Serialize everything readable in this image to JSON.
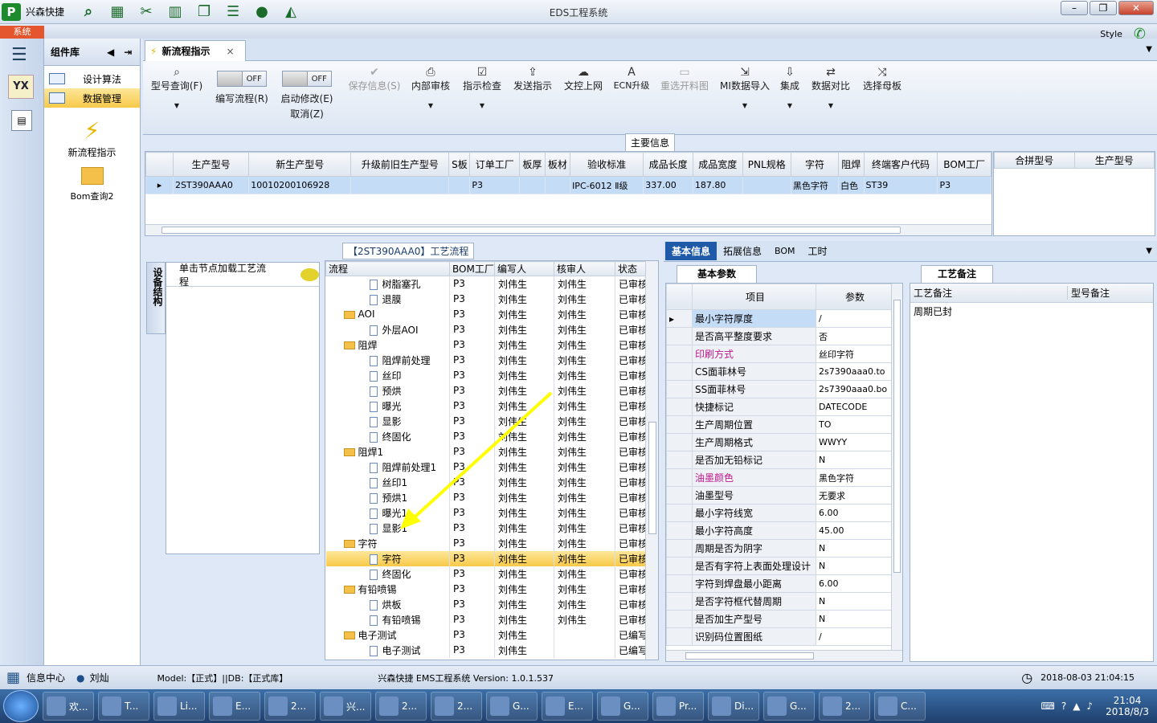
{
  "app": {
    "logo": "P",
    "name": "兴森快捷",
    "window_title": "EDS工程系统",
    "style_label": "Style"
  },
  "menu": {
    "system_tab": "系统"
  },
  "left_icons": [
    "YX",
    "calendar"
  ],
  "library": {
    "title": "组件库",
    "items": [
      {
        "label": "设计算法",
        "selected": false
      },
      {
        "label": "数据管理",
        "selected": true
      }
    ],
    "big_items": [
      {
        "label": "新流程指示",
        "icon": "lightning-icon"
      },
      {
        "label": "Bom查询2",
        "icon": "folder-open-icon"
      }
    ]
  },
  "doc_tab": {
    "label": "新流程指示",
    "close": "×"
  },
  "ribbon": {
    "model_query": "型号查询(F)",
    "toggle_off": "OFF",
    "edit_flow": "编写流程(R)",
    "start_modify": "启动修改(E)",
    "cancel": "取消(Z)",
    "save_info": "保存信息(S)",
    "internal_review": "内部审核",
    "instruction_check": "指示检查",
    "send_instruction": "发送指示",
    "upload": "文控上网",
    "ecn_upgrade": "ECN升级",
    "reselect": "重选开料图",
    "mi_import": "MI数据导入",
    "integrate": "集成",
    "data_compare": "数据对比",
    "select_master": "选择母板"
  },
  "main_info": {
    "title": "主要信息",
    "columns": [
      "生产型号",
      "新生产型号",
      "升级前旧生产型号",
      "S板",
      "订单工厂",
      "板厚",
      "板材",
      "验收标准",
      "成品长度",
      "成品宽度",
      "PNL规格",
      "字符",
      "阻焊",
      "终端客户代码",
      "BOM工厂"
    ],
    "row": [
      "2ST390AAA0",
      "10010200106928",
      "",
      "",
      "P3",
      "",
      "",
      "IPC-6012 Ⅱ级",
      "337.00",
      "187.80",
      "",
      "黑色字符",
      "白色",
      "ST39",
      "P3"
    ],
    "side_columns": [
      "合拼型号",
      "生产型号"
    ]
  },
  "flow": {
    "title": "【2ST390AAA0】工艺流程",
    "side_tab": "设备结构",
    "hint": "单击节点加载工艺流程",
    "columns": [
      "流程",
      "BOM工厂",
      "编写人",
      "核审人",
      "状态"
    ],
    "rows": [
      {
        "level": 2,
        "type": "doc",
        "name": "树脂塞孔",
        "bom": "P3",
        "writer": "刘伟生",
        "reviewer": "刘伟生",
        "status": "已审核"
      },
      {
        "level": 2,
        "type": "doc",
        "name": "退膜",
        "bom": "P3",
        "writer": "刘伟生",
        "reviewer": "刘伟生",
        "status": "已审核"
      },
      {
        "level": 1,
        "type": "folder",
        "name": "AOI",
        "bom": "P3",
        "writer": "刘伟生",
        "reviewer": "刘伟生",
        "status": "已审核"
      },
      {
        "level": 2,
        "type": "doc",
        "name": "外层AOI",
        "bom": "P3",
        "writer": "刘伟生",
        "reviewer": "刘伟生",
        "status": "已审核"
      },
      {
        "level": 1,
        "type": "folder",
        "name": "阻焊",
        "bom": "P3",
        "writer": "刘伟生",
        "reviewer": "刘伟生",
        "status": "已审核"
      },
      {
        "level": 2,
        "type": "doc",
        "name": "阻焊前处理",
        "bom": "P3",
        "writer": "刘伟生",
        "reviewer": "刘伟生",
        "status": "已审核"
      },
      {
        "level": 2,
        "type": "doc",
        "name": "丝印",
        "bom": "P3",
        "writer": "刘伟生",
        "reviewer": "刘伟生",
        "status": "已审核"
      },
      {
        "level": 2,
        "type": "doc",
        "name": "预烘",
        "bom": "P3",
        "writer": "刘伟生",
        "reviewer": "刘伟生",
        "status": "已审核"
      },
      {
        "level": 2,
        "type": "doc",
        "name": "曝光",
        "bom": "P3",
        "writer": "刘伟生",
        "reviewer": "刘伟生",
        "status": "已审核"
      },
      {
        "level": 2,
        "type": "doc",
        "name": "显影",
        "bom": "P3",
        "writer": "刘伟生",
        "reviewer": "刘伟生",
        "status": "已审核"
      },
      {
        "level": 2,
        "type": "doc",
        "name": "终固化",
        "bom": "P3",
        "writer": "刘伟生",
        "reviewer": "刘伟生",
        "status": "已审核"
      },
      {
        "level": 1,
        "type": "folder",
        "name": "阻焊1",
        "bom": "P3",
        "writer": "刘伟生",
        "reviewer": "刘伟生",
        "status": "已审核"
      },
      {
        "level": 2,
        "type": "doc",
        "name": "阻焊前处理1",
        "bom": "P3",
        "writer": "刘伟生",
        "reviewer": "刘伟生",
        "status": "已审核"
      },
      {
        "level": 2,
        "type": "doc",
        "name": "丝印1",
        "bom": "P3",
        "writer": "刘伟生",
        "reviewer": "刘伟生",
        "status": "已审核"
      },
      {
        "level": 2,
        "type": "doc",
        "name": "预烘1",
        "bom": "P3",
        "writer": "刘伟生",
        "reviewer": "刘伟生",
        "status": "已审核"
      },
      {
        "level": 2,
        "type": "doc",
        "name": "曝光1",
        "bom": "P3",
        "writer": "刘伟生",
        "reviewer": "刘伟生",
        "status": "已审核"
      },
      {
        "level": 2,
        "type": "doc",
        "name": "显影1",
        "bom": "P3",
        "writer": "刘伟生",
        "reviewer": "刘伟生",
        "status": "已审核"
      },
      {
        "level": 1,
        "type": "folder",
        "name": "字符",
        "bom": "P3",
        "writer": "刘伟生",
        "reviewer": "刘伟生",
        "status": "已审核"
      },
      {
        "level": 2,
        "type": "doc",
        "name": "字符",
        "bom": "P3",
        "writer": "刘伟生",
        "reviewer": "刘伟生",
        "status": "已审核",
        "selected": true
      },
      {
        "level": 2,
        "type": "doc",
        "name": "终固化",
        "bom": "P3",
        "writer": "刘伟生",
        "reviewer": "刘伟生",
        "status": "已审核"
      },
      {
        "level": 1,
        "type": "folder",
        "name": "有铅喷锡",
        "bom": "P3",
        "writer": "刘伟生",
        "reviewer": "刘伟生",
        "status": "已审核"
      },
      {
        "level": 2,
        "type": "doc",
        "name": "烘板",
        "bom": "P3",
        "writer": "刘伟生",
        "reviewer": "刘伟生",
        "status": "已审核"
      },
      {
        "level": 2,
        "type": "doc",
        "name": "有铅喷锡",
        "bom": "P3",
        "writer": "刘伟生",
        "reviewer": "刘伟生",
        "status": "已审核"
      },
      {
        "level": 1,
        "type": "folder",
        "name": "电子测试",
        "bom": "P3",
        "writer": "刘伟生",
        "reviewer": "",
        "status": "已编写"
      },
      {
        "level": 2,
        "type": "doc",
        "name": "电子测试",
        "bom": "P3",
        "writer": "刘伟生",
        "reviewer": "",
        "status": "已编写"
      }
    ]
  },
  "detail_tabs": [
    "基本信息",
    "拓展信息",
    "BOM",
    "工时"
  ],
  "basic_params": {
    "tab": "基本参数",
    "col_item": "项目",
    "col_param": "参数",
    "rows": [
      {
        "item": "最小字符厚度",
        "value": "/",
        "highlight": false,
        "selected": true
      },
      {
        "item": "是否高平整度要求",
        "value": "否",
        "highlight": false
      },
      {
        "item": "印刷方式",
        "value": "丝印字符",
        "highlight": true
      },
      {
        "item": "CS面菲林号",
        "value": "2s7390aaa0.to",
        "highlight": false
      },
      {
        "item": "SS面菲林号",
        "value": "2s7390aaa0.bo",
        "highlight": false
      },
      {
        "item": "快捷标记",
        "value": "DATECODE",
        "highlight": false
      },
      {
        "item": "生产周期位置",
        "value": "TO",
        "highlight": false
      },
      {
        "item": "生产周期格式",
        "value": "WWYY",
        "highlight": false
      },
      {
        "item": "是否加无铅标记",
        "value": "N",
        "highlight": false
      },
      {
        "item": "油墨颜色",
        "value": "黑色字符",
        "highlight": true
      },
      {
        "item": "油墨型号",
        "value": "无要求",
        "highlight": false
      },
      {
        "item": "最小字符线宽",
        "value": "6.00",
        "highlight": false
      },
      {
        "item": "最小字符高度",
        "value": "45.00",
        "highlight": false
      },
      {
        "item": "周期是否为阴字",
        "value": "N",
        "highlight": false
      },
      {
        "item": "是否有字符上表面处理设计",
        "value": "N",
        "highlight": false
      },
      {
        "item": "字符到焊盘最小距离",
        "value": "6.00",
        "highlight": false
      },
      {
        "item": "是否字符框代替周期",
        "value": "N",
        "highlight": false
      },
      {
        "item": "是否加生产型号",
        "value": "N",
        "highlight": false
      },
      {
        "item": "识别码位置图纸",
        "value": "/",
        "highlight": false
      }
    ]
  },
  "process_notes": {
    "tab": "工艺备注",
    "col_process": "工艺备注",
    "col_model": "型号备注",
    "process_value": "周期已封"
  },
  "status": {
    "info_center": "信息中心",
    "user": "刘灿",
    "model": "Model:【正式】||DB:【正式库】",
    "product": "兴森快捷 EMS工程系统 Version: 1.0.1.537",
    "datetime": "2018-08-03 21:04:15"
  },
  "taskbar": {
    "buttons": [
      "欢...",
      "T...",
      "Li...",
      "E...",
      "2...",
      "兴...",
      "2...",
      "2...",
      "G...",
      "E...",
      "G...",
      "Pr...",
      "Di...",
      "G...",
      "2...",
      "C..."
    ],
    "time": "21:04",
    "date": "2018/8/3"
  }
}
